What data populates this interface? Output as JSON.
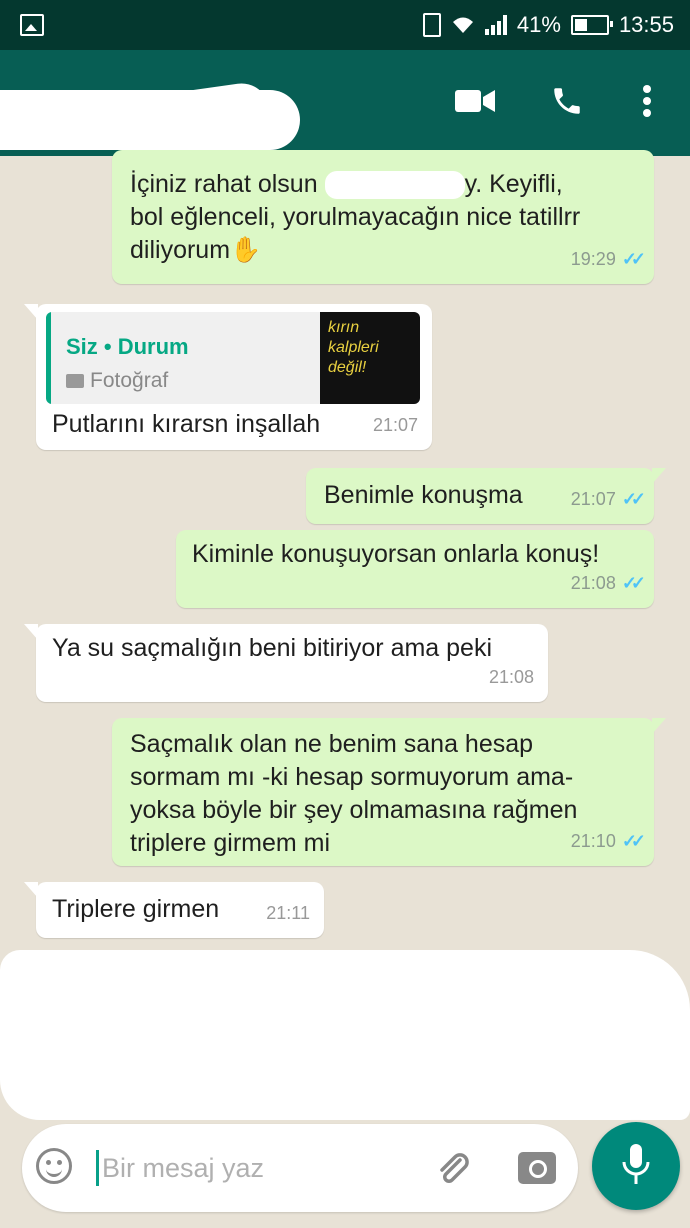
{
  "status_bar": {
    "battery": "41%",
    "battery_level": 0.41,
    "time": "13:55"
  },
  "header": {
    "icons": [
      "video-call-icon",
      "phone-icon",
      "more-vert-icon"
    ]
  },
  "messages": [
    {
      "direction": "out",
      "lines": [
        "İçiniz rahat olsun",
        "y. Keyifli,",
        "bol eğlenceli, yorulmayacağın nice tatillrr",
        "diliyorum"
      ],
      "emoji": "✋",
      "time": "19:29",
      "ticks": "✓✓"
    },
    {
      "direction": "in",
      "quote": {
        "author": "Siz • Durum",
        "type": "Fotoğraf",
        "thumb_lines": [
          "kırın",
          "kalpleri",
          "değil!"
        ]
      },
      "text": "Putlarını kırarsn inşallah",
      "time": "21:07"
    },
    {
      "direction": "out",
      "text": "Benimle konuşma",
      "time": "21:07",
      "ticks": "✓✓"
    },
    {
      "direction": "out",
      "text": "Kiminle konuşuyorsan onlarla konuş!",
      "time": "21:08",
      "ticks": "✓✓"
    },
    {
      "direction": "in",
      "text": "Ya su saçmalığın beni bitiriyor ama peki",
      "time": "21:08"
    },
    {
      "direction": "out",
      "lines": [
        "Saçmalık olan ne benim sana hesap",
        "sormam mı -ki hesap sormuyorum ama-",
        "yoksa böyle bir şey olmamasına rağmen",
        "triplere girmem mi"
      ],
      "time": "21:10",
      "ticks": "✓✓"
    },
    {
      "direction": "in",
      "text": "Triplere girmen",
      "time": "21:11"
    }
  ],
  "composer": {
    "placeholder": "Bir mesaj yaz",
    "value": ""
  },
  "colors": {
    "header": "#075e54",
    "status_bar": "#04382f",
    "outgoing_bubble": "#dcf8c6",
    "incoming_bubble": "#ffffff",
    "read_ticks": "#4fc3f7",
    "fab": "#00897b"
  }
}
